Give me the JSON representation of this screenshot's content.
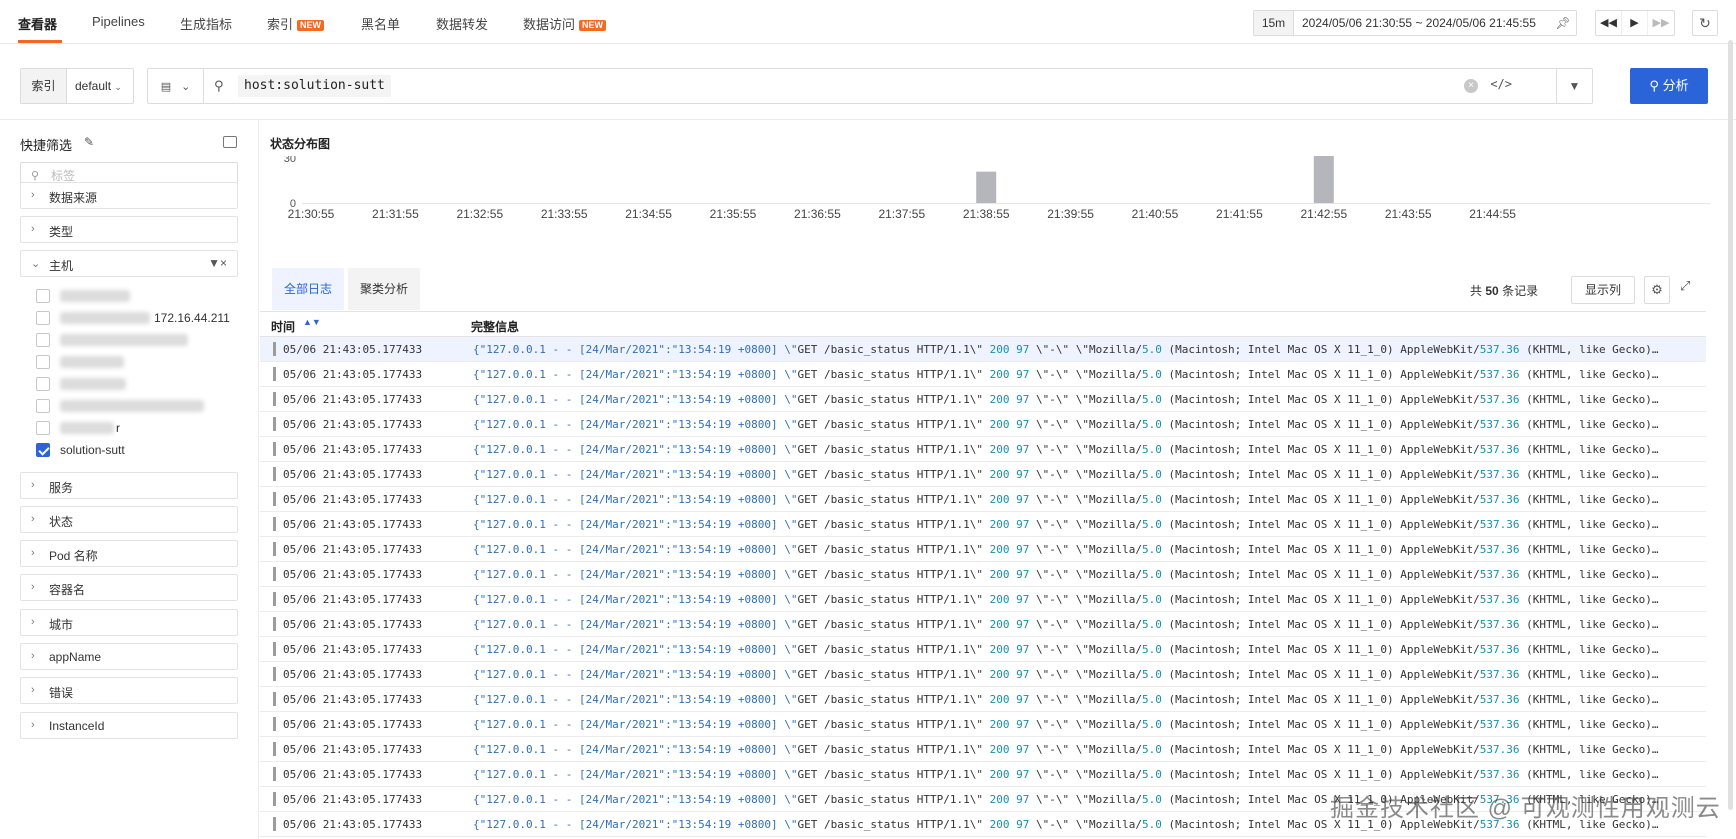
{
  "nav": {
    "tabs": [
      {
        "label": "查看器",
        "active": true
      },
      {
        "label": "Pipelines"
      },
      {
        "label": "生成指标"
      },
      {
        "label": "索引",
        "badge": "NEW"
      },
      {
        "label": "黑名单"
      },
      {
        "label": "数据转发"
      },
      {
        "label": "数据访问",
        "badge": "NEW"
      }
    ],
    "time_duration": "15m",
    "time_range": "2024/05/06 21:30:55 ~ 2024/05/06 21:45:55"
  },
  "query": {
    "index_label": "索引",
    "index_value": "default",
    "query_text": "host:solution-sutt",
    "analyze_label": "分析"
  },
  "sidebar": {
    "title": "快捷筛选",
    "search_placeholder": "标签",
    "facets_top": [
      "数据来源",
      "类型"
    ],
    "host_facet": "主机",
    "host_visible_fragments": [
      "172.16.44.211",
      "r"
    ],
    "host_selected": "solution-sutt",
    "facets_bottom": [
      "服务",
      "状态",
      "Pod 名称",
      "容器名",
      "城市",
      "appName",
      "错误",
      "InstanceId"
    ]
  },
  "chart": {
    "title": "状态分布图"
  },
  "chart_data": {
    "type": "bar",
    "title": "状态分布图",
    "categories": [
      "21:30:55",
      "21:31:55",
      "21:32:55",
      "21:33:55",
      "21:34:55",
      "21:35:55",
      "21:36:55",
      "21:37:55",
      "21:38:55",
      "21:39:55",
      "21:40:55",
      "21:41:55",
      "21:42:55",
      "21:43:55",
      "21:44:55"
    ],
    "values": [
      0,
      0,
      0,
      0,
      0,
      0,
      0,
      0,
      20,
      0,
      0,
      0,
      30,
      0,
      0
    ],
    "ylim": [
      0,
      30
    ],
    "yticks": [
      0,
      30
    ],
    "color": "#b4b6bb",
    "grid": false
  },
  "logs": {
    "tab_all": "全部日志",
    "tab_cluster": "聚类分析",
    "count_prefix": "共",
    "count_value": "50",
    "count_suffix": "条记录",
    "columns_btn": "显示列",
    "col_time": "时间",
    "col_message": "完整信息",
    "row_time": "05/06 21:43:05.177433",
    "row_message": "{\"127.0.0.1 - - [24/Mar/2021\":\"13:54:19 +0800] \\\"GET /basic_status HTTP/1.1\\\" 200 97 \\\"-\\\" \\\"Mozilla/5.0 (Macintosh; Intel Mac OS X 11_1_0) AppleWebKit/537.36 (KHTML, like Gecko)…",
    "row_count": 20
  },
  "watermark": "掘金技术社区 @ 可观测性用观测云"
}
